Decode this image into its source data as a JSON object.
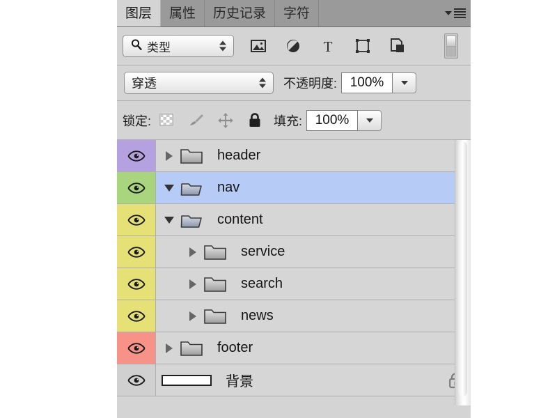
{
  "panel": {
    "tabs": [
      {
        "label": "图层",
        "active": true
      },
      {
        "label": "属性",
        "active": false
      },
      {
        "label": "历史记录",
        "active": false
      },
      {
        "label": "字符",
        "active": false
      }
    ],
    "menu_icon": "panel-menu-icon"
  },
  "filter_row": {
    "select_value": "类型",
    "icons": [
      "pixel-layer-filter-icon",
      "adjustment-layer-filter-icon",
      "type-layer-filter-icon",
      "shape-layer-filter-icon",
      "smart-object-filter-icon"
    ],
    "toggle": "filter-enable-toggle"
  },
  "blend_row": {
    "blend_mode": "穿透",
    "opacity_label": "不透明度:",
    "opacity_value": "100%"
  },
  "lock_row": {
    "lock_label": "锁定:",
    "icons": [
      "lock-transparency-icon",
      "lock-image-pixels-icon",
      "lock-position-icon",
      "lock-all-icon"
    ],
    "fill_label": "填充:",
    "fill_value": "100%"
  },
  "layers": [
    {
      "name": "header",
      "color": "#b6a1e0",
      "expanded": false,
      "indent": 0,
      "selected": false,
      "kind": "folder",
      "locked": false
    },
    {
      "name": "nav",
      "color": "#a8d57e",
      "expanded": true,
      "indent": 0,
      "selected": true,
      "kind": "folder",
      "locked": false
    },
    {
      "name": "content",
      "color": "#e6e177",
      "expanded": true,
      "indent": 0,
      "selected": false,
      "kind": "folder",
      "locked": false
    },
    {
      "name": "service",
      "color": "#e6e177",
      "expanded": false,
      "indent": 1,
      "selected": false,
      "kind": "folder",
      "locked": false
    },
    {
      "name": "search",
      "color": "#e6e177",
      "expanded": false,
      "indent": 1,
      "selected": false,
      "kind": "folder",
      "locked": false
    },
    {
      "name": "news",
      "color": "#e6e177",
      "expanded": false,
      "indent": 1,
      "selected": false,
      "kind": "folder",
      "locked": false
    },
    {
      "name": "footer",
      "color": "#f79289",
      "expanded": false,
      "indent": 0,
      "selected": false,
      "kind": "folder",
      "locked": false
    },
    {
      "name": "背景",
      "color": "#d0d0d0",
      "expanded": null,
      "indent": 0,
      "selected": false,
      "kind": "image",
      "locked": true
    }
  ],
  "colors": {
    "panel_bg": "#d4d4d4",
    "tabbar_bg": "#9a9a9a",
    "row_bg": "#d6d6d6",
    "selected_row": "#b7cbf7",
    "text": "#141414"
  }
}
